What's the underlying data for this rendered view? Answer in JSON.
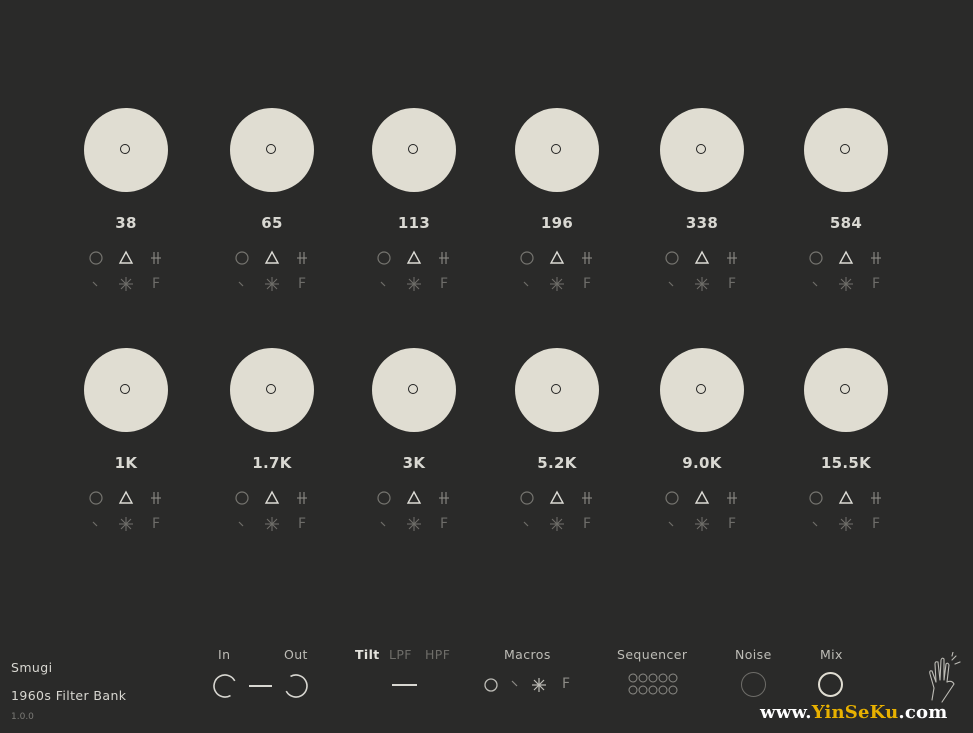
{
  "bands": [
    {
      "freq": "38"
    },
    {
      "freq": "65"
    },
    {
      "freq": "113"
    },
    {
      "freq": "196"
    },
    {
      "freq": "338"
    },
    {
      "freq": "584"
    },
    {
      "freq": "1K"
    },
    {
      "freq": "1.7K"
    },
    {
      "freq": "3K"
    },
    {
      "freq": "5.2K"
    },
    {
      "freq": "9.0K"
    },
    {
      "freq": "15.5K"
    }
  ],
  "band_icon_names": [
    "circle-toggle-icon",
    "triangle-shape-icon",
    "tick-lines-icon",
    "slash-icon",
    "asterisk-icon",
    "f-letter-icon"
  ],
  "band_icon_f": "F",
  "brand": {
    "name": "Smugi",
    "product": "1960s Filter Bank",
    "version": "1.0.0"
  },
  "controls": {
    "in_label": "In",
    "out_label": "Out",
    "tilt_label": "Tilt",
    "lpf_label": "LPF",
    "hpf_label": "HPF",
    "macros_label": "Macros",
    "macros_f": "F",
    "sequencer_label": "Sequencer",
    "noise_label": "Noise",
    "mix_label": "Mix"
  },
  "watermark": {
    "pre": "www.",
    "mid": "YinSeKu",
    "post": ".com"
  },
  "colors": {
    "background": "#2a2a29",
    "knob": "#e0ddd2",
    "text": "#d8d7d1",
    "dim": "#6e6d69"
  }
}
